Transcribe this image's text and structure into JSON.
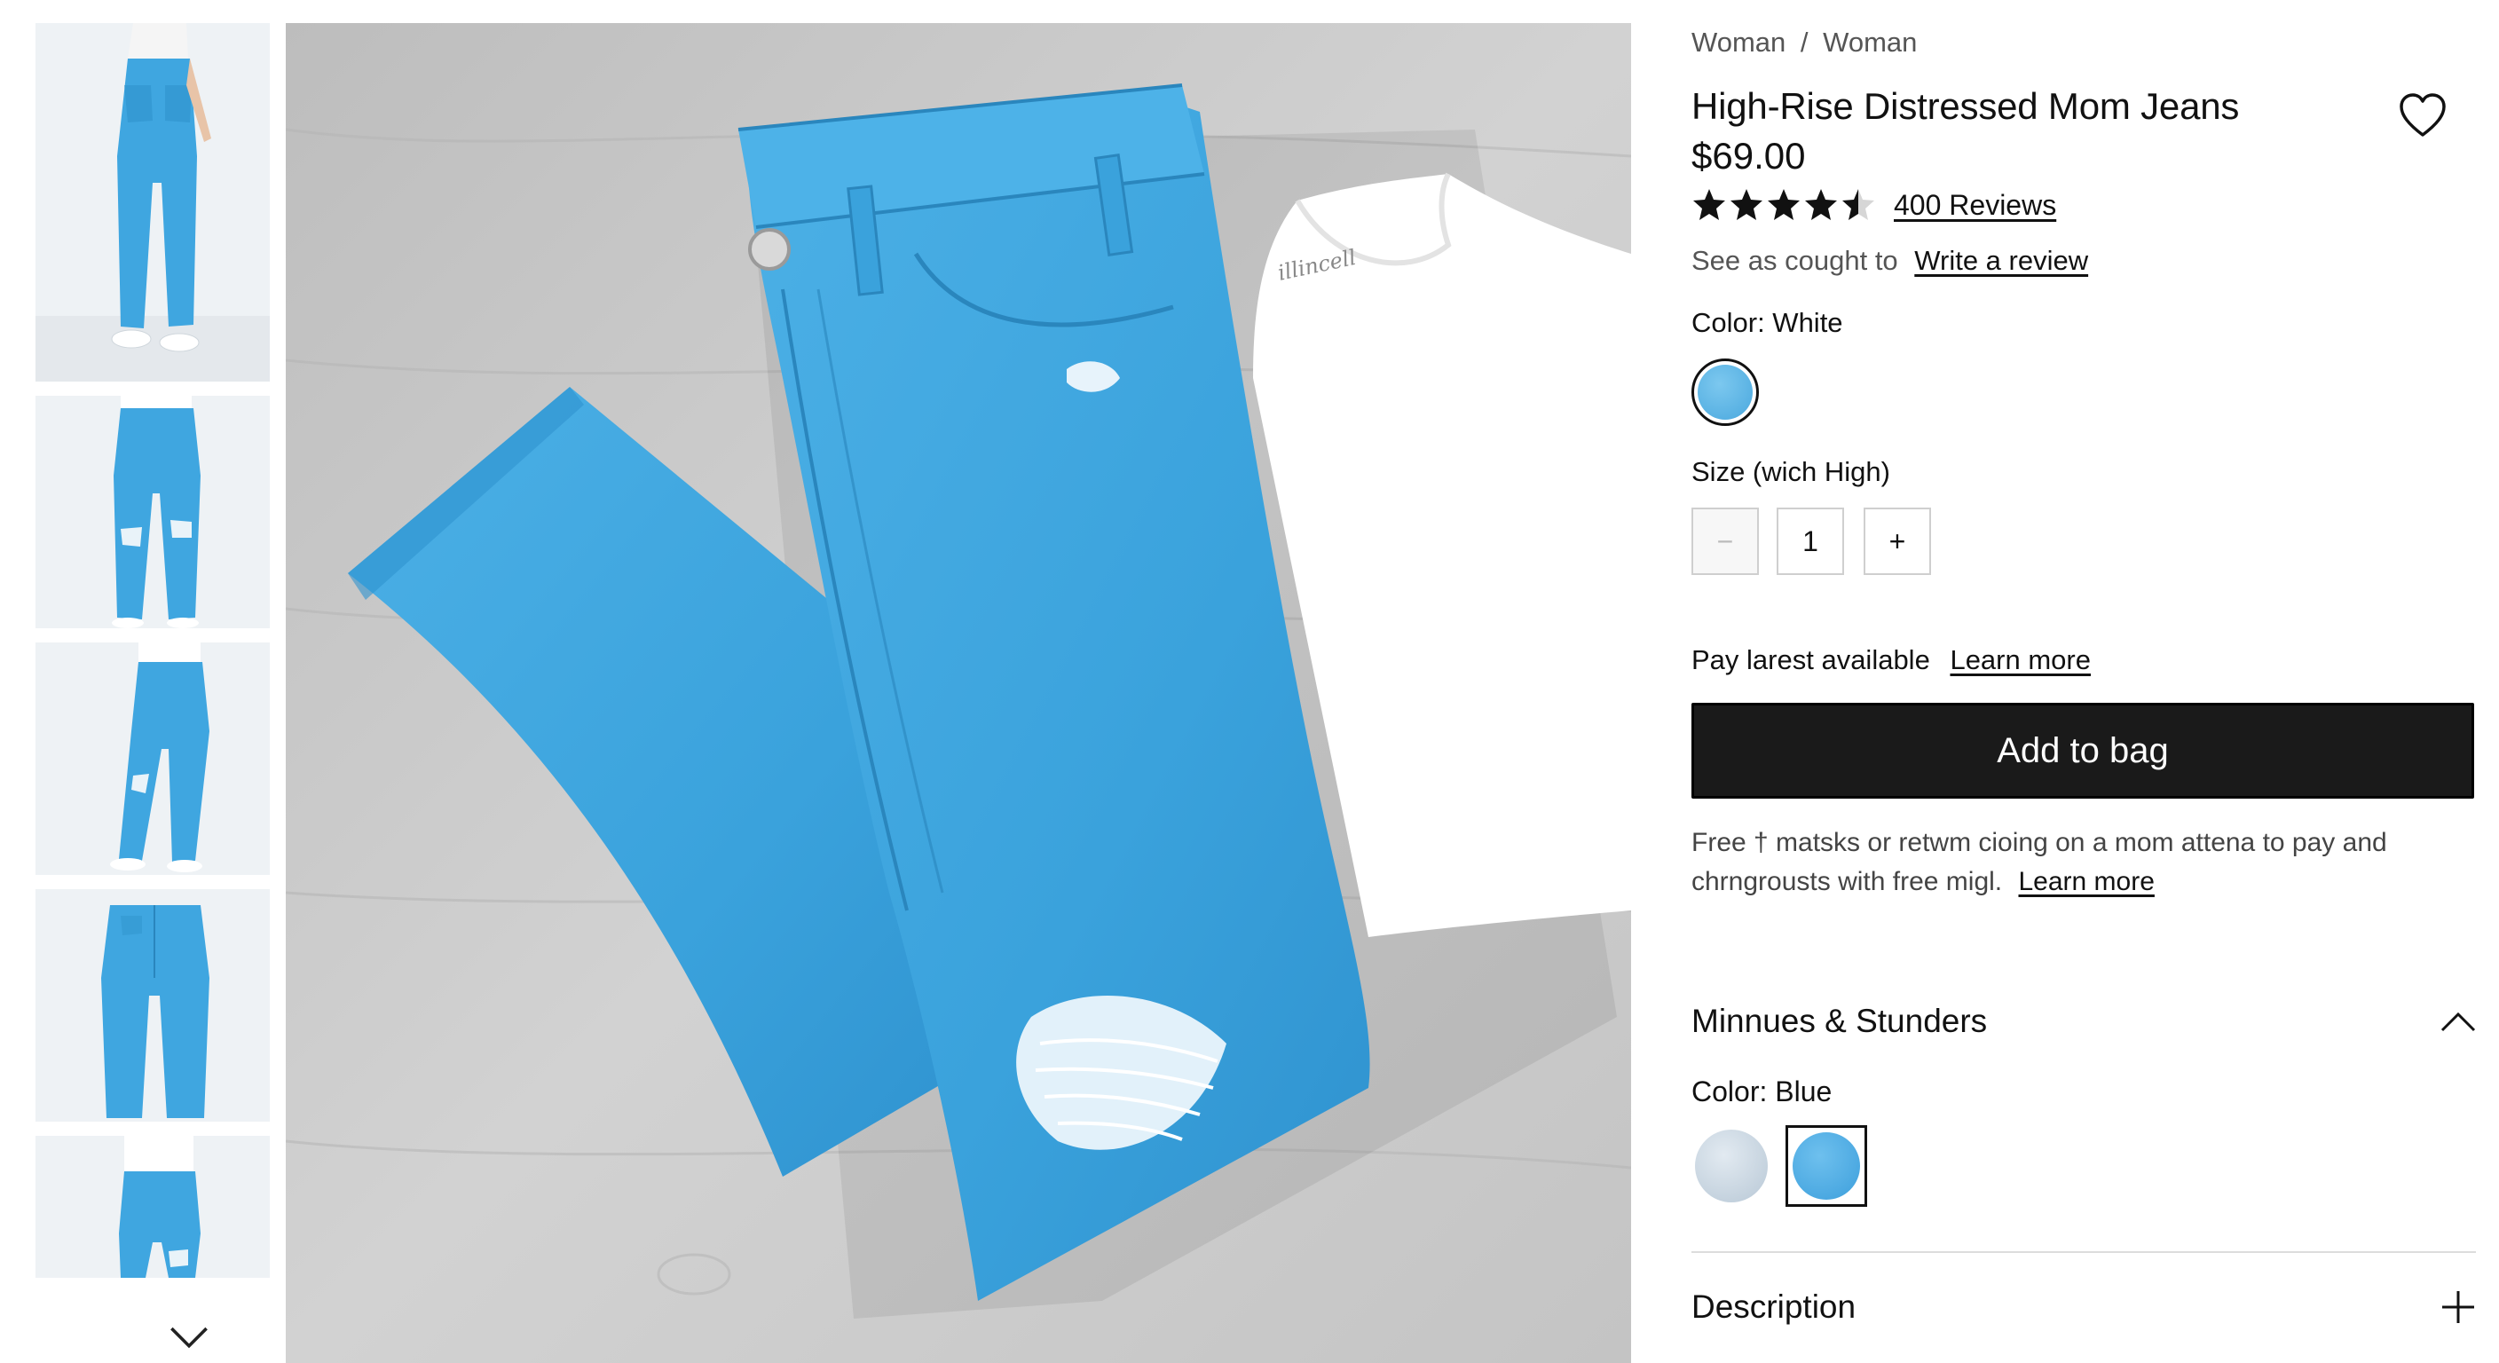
{
  "breadcrumb": [
    "Woman",
    "Woman"
  ],
  "breadcrumb_separator": "/",
  "product": {
    "title": "High-Rise Distressed Mom Jeans",
    "price": "$69.00",
    "rating": 4.5,
    "rating_max": 5,
    "reviews_link": "400 Reviews",
    "review_prompt": "See as cought to",
    "write_review_link": "Write a review"
  },
  "color_selector": {
    "label": "Color: White",
    "swatch_color": "#4aa8de"
  },
  "size_selector": {
    "label": "Size (wich High)",
    "quantity": "1",
    "minus_symbol": "−",
    "plus_symbol": "+"
  },
  "payment": {
    "text": "Pay larest available",
    "link": "Learn more"
  },
  "cta": {
    "add_to_bag": "Add to bag"
  },
  "shipping": {
    "text": "Free † matsks or retwm cioing on a mom attena to pay and chrngrousts with free migl.",
    "link": "Learn more"
  },
  "sections": {
    "fits": {
      "title": "Minnues & Stunders",
      "expanded": true,
      "color_label": "Color: Blue",
      "swatches": [
        {
          "name": "light-wash",
          "color": "#b8c8d6",
          "selected": false
        },
        {
          "name": "medium-blue",
          "color": "#3d9fdc",
          "selected": true
        }
      ]
    },
    "description": {
      "title": "Description",
      "expanded": false
    }
  },
  "icons": {
    "wishlist": "heart-icon",
    "thumbnails_next": "chevron-down-icon",
    "accordion_open": "chevron-up-icon",
    "accordion_closed": "plus-icon"
  },
  "colors": {
    "denim": "#3fa6e0",
    "button_bg": "#1a1a1a",
    "text": "#111111",
    "muted_text": "#555555",
    "floor": "#c9c9c9"
  }
}
